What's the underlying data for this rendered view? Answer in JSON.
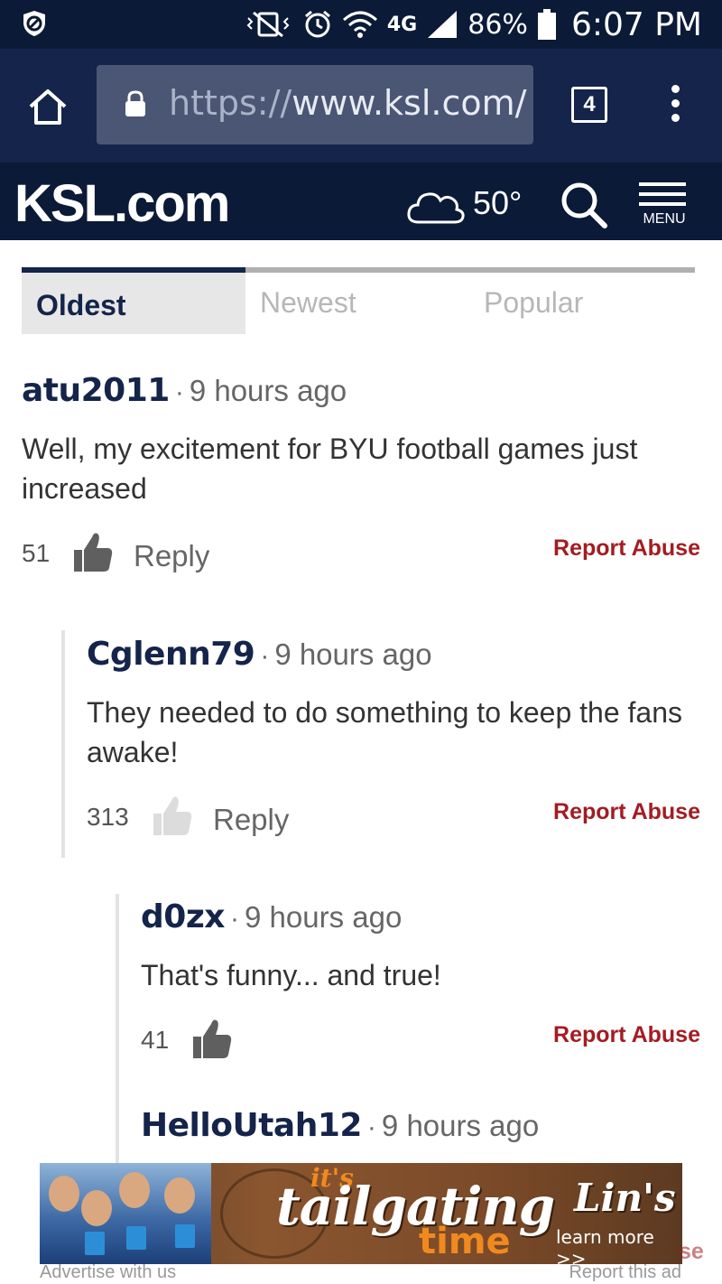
{
  "status_bar": {
    "battery": "86%",
    "time": "6:07 PM",
    "network": "4G"
  },
  "browser": {
    "url_scheme": "https://",
    "url_host": "www.ksl.com/",
    "tab_count": "4"
  },
  "site": {
    "logo": "KSL.com",
    "temperature": "50°",
    "menu_label": "MENU"
  },
  "sort_tabs": {
    "oldest": "Oldest",
    "newest": "Newest",
    "popular": "Popular",
    "active": "Oldest"
  },
  "comments": [
    {
      "author": "atu2011",
      "time": "9 hours ago",
      "body": "Well, my excitement for BYU football games just increased",
      "votes": "51",
      "reply": "Reply",
      "report": "Report Abuse"
    },
    {
      "author": "Cglenn79",
      "time": "9 hours ago",
      "body": "They needed to do something to keep the fans awake!",
      "votes": "313",
      "reply": "Reply",
      "report": "Report Abuse"
    },
    {
      "author": "d0zx",
      "time": "9 hours ago",
      "body": "That's funny... and true!",
      "votes": "41",
      "report": "Report Abuse"
    },
    {
      "author": "HelloUtah12",
      "time": "9 hours ago"
    }
  ],
  "ad": {
    "its": "it's",
    "headline": "tailgating",
    "time_word": "time",
    "brand": "Lin's",
    "cta": "learn more >>",
    "advertise": "Advertise with us",
    "report": "Report this ad",
    "partial_report": "se"
  },
  "colors": {
    "header_navy": "#0b1a36",
    "browser_bar": "#14244a",
    "author_navy": "#14244a",
    "report_red": "#a31c22"
  }
}
